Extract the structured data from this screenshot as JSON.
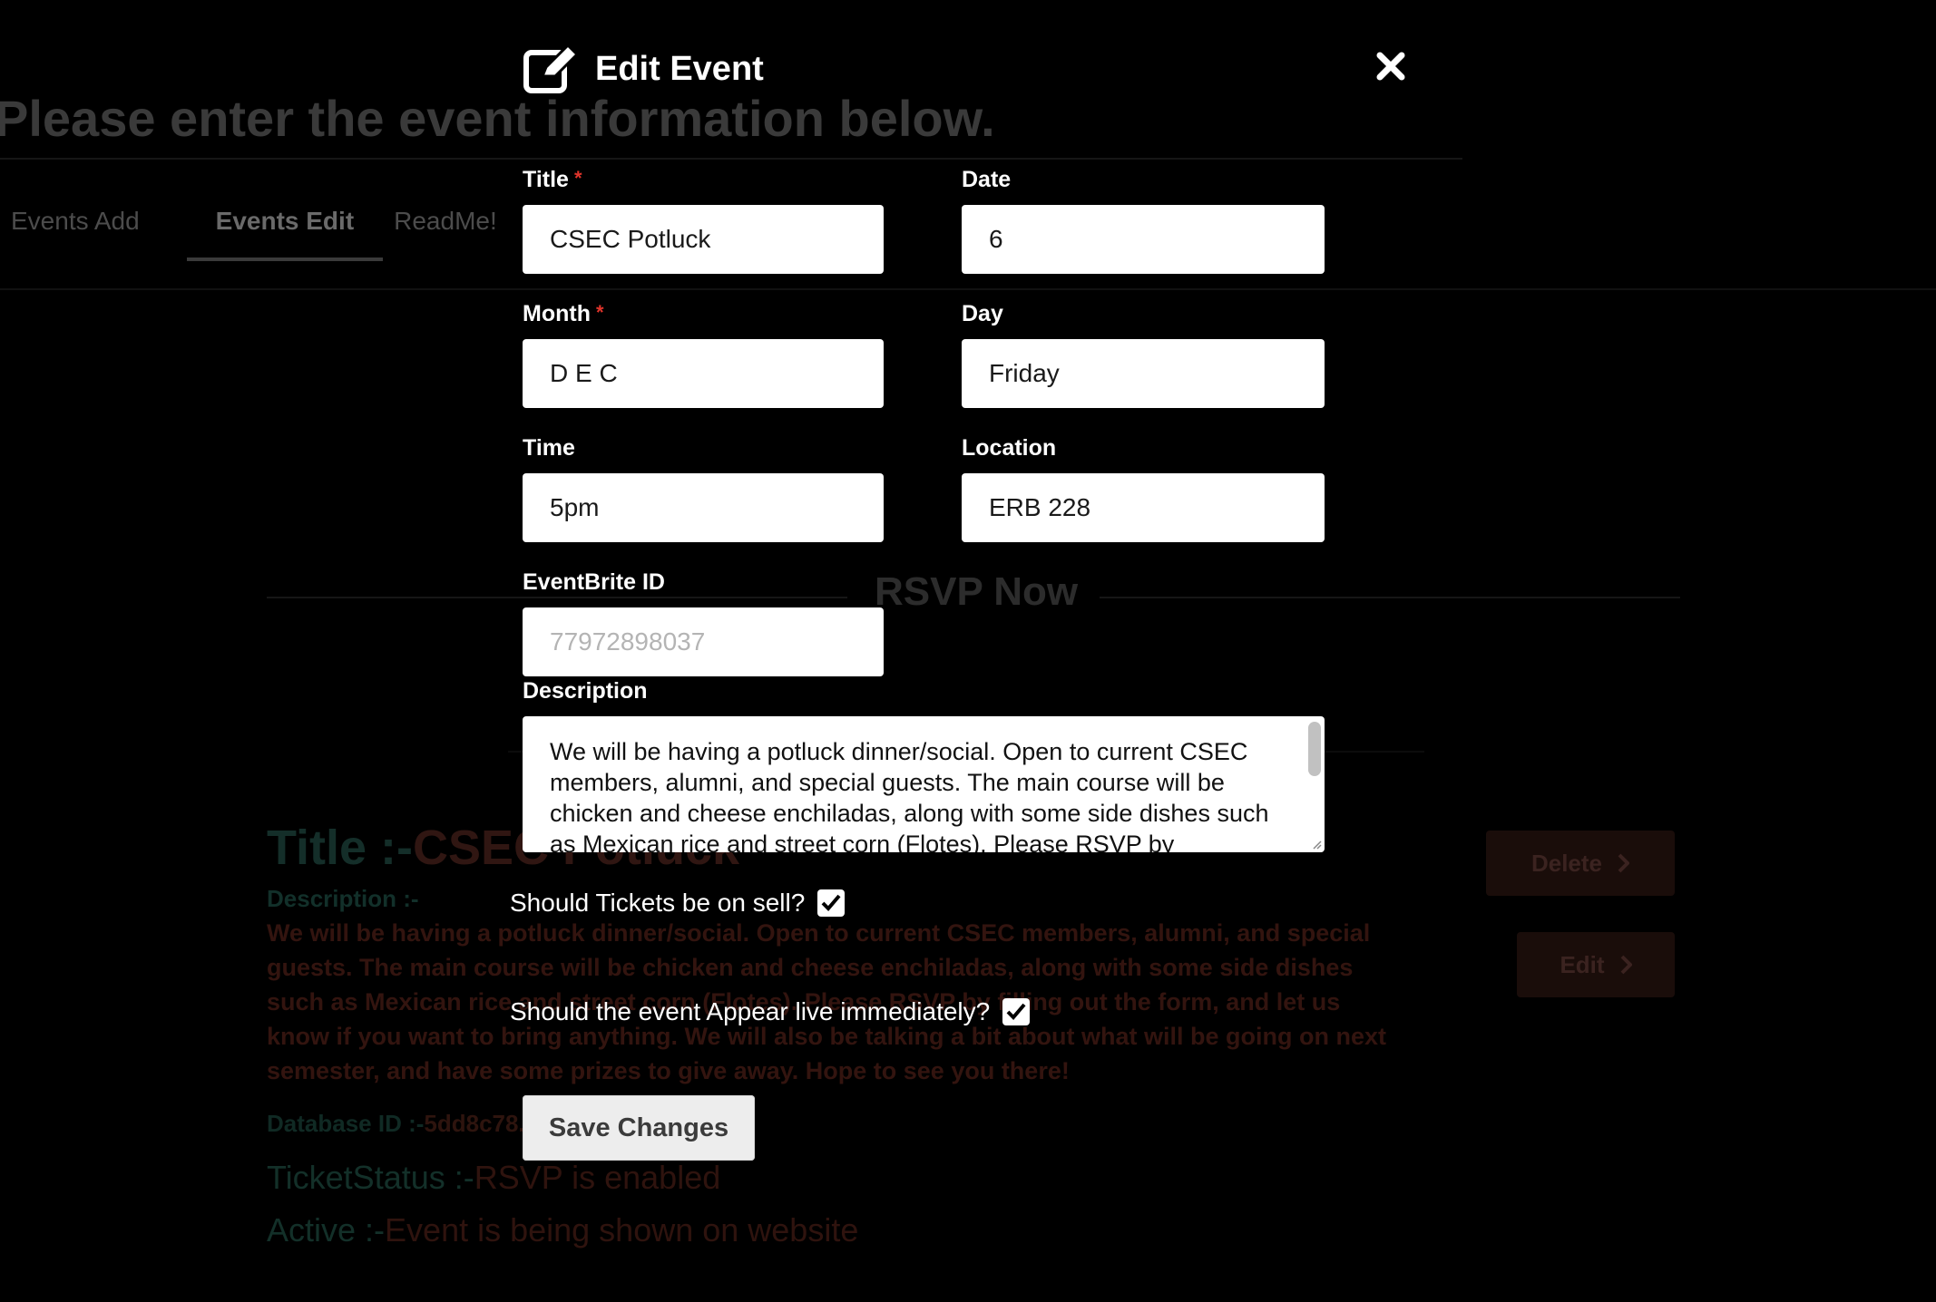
{
  "background": {
    "heading": "Please enter the event information below.",
    "tabs": [
      "Events Add",
      "Events Edit",
      "ReadMe!"
    ],
    "active_tab": "Events Edit",
    "rsvp_heading": "RSVP Now",
    "event": {
      "title_key": "Title :-",
      "title_value": "CSEC Potluck",
      "description_label": "Description :-",
      "description": "We will be having a potluck dinner/social. Open to current CSEC members, alumni, and special guests. The main course will be chicken and cheese enchiladas, along with some side dishes such as Mexican rice and street corn (Flotes). Please RSVP by filling out the form, and let us know if you want to bring anything. We will also be talking a bit about what will be going on next semester, and have some prizes to give away. Hope to see you there!",
      "database_id_key": "Database ID :-",
      "database_id_value": "5dd8c78...e",
      "ticket_status_key": "TicketStatus :-",
      "ticket_status_value": "RSVP is enabled",
      "active_key": "Active :-",
      "active_value": "Event is being shown on website"
    },
    "delete_label": "Delete",
    "edit_label": "Edit"
  },
  "modal": {
    "title": "Edit Event",
    "fields": {
      "title": {
        "label": "Title",
        "value": "CSEC Potluck",
        "required": true
      },
      "date": {
        "label": "Date",
        "value": "6"
      },
      "month": {
        "label": "Month",
        "value": "D E C",
        "required": true
      },
      "day": {
        "label": "Day",
        "value": "Friday"
      },
      "time": {
        "label": "Time",
        "value": "5pm"
      },
      "location": {
        "label": "Location",
        "value": "ERB 228"
      },
      "eventbrite_id": {
        "label": "EventBrite ID",
        "placeholder": "77972898037"
      },
      "description": {
        "label": "Description",
        "value": "We will be having a potluck dinner/social. Open to current CSEC members, alumni, and special guests. The main course will be chicken and cheese enchiladas, along with some side dishes such as Mexican rice and street corn (Flotes). Please RSVP by"
      }
    },
    "tickets_on_sell": {
      "label": "Should Tickets be on sell?",
      "checked": true
    },
    "appear_live": {
      "label": "Should the event Appear live immediately?",
      "checked": true
    },
    "save_label": "Save Changes",
    "required_marker": "*"
  },
  "colors": {
    "required": "#e0342b",
    "overlay": "#000000",
    "input_bg": "#ffffff",
    "save_button_bg": "#ededed"
  },
  "icons": {
    "header": "edit-icon",
    "close": "close-icon",
    "check": "check-icon",
    "chevron": "chevron-right-icon"
  }
}
